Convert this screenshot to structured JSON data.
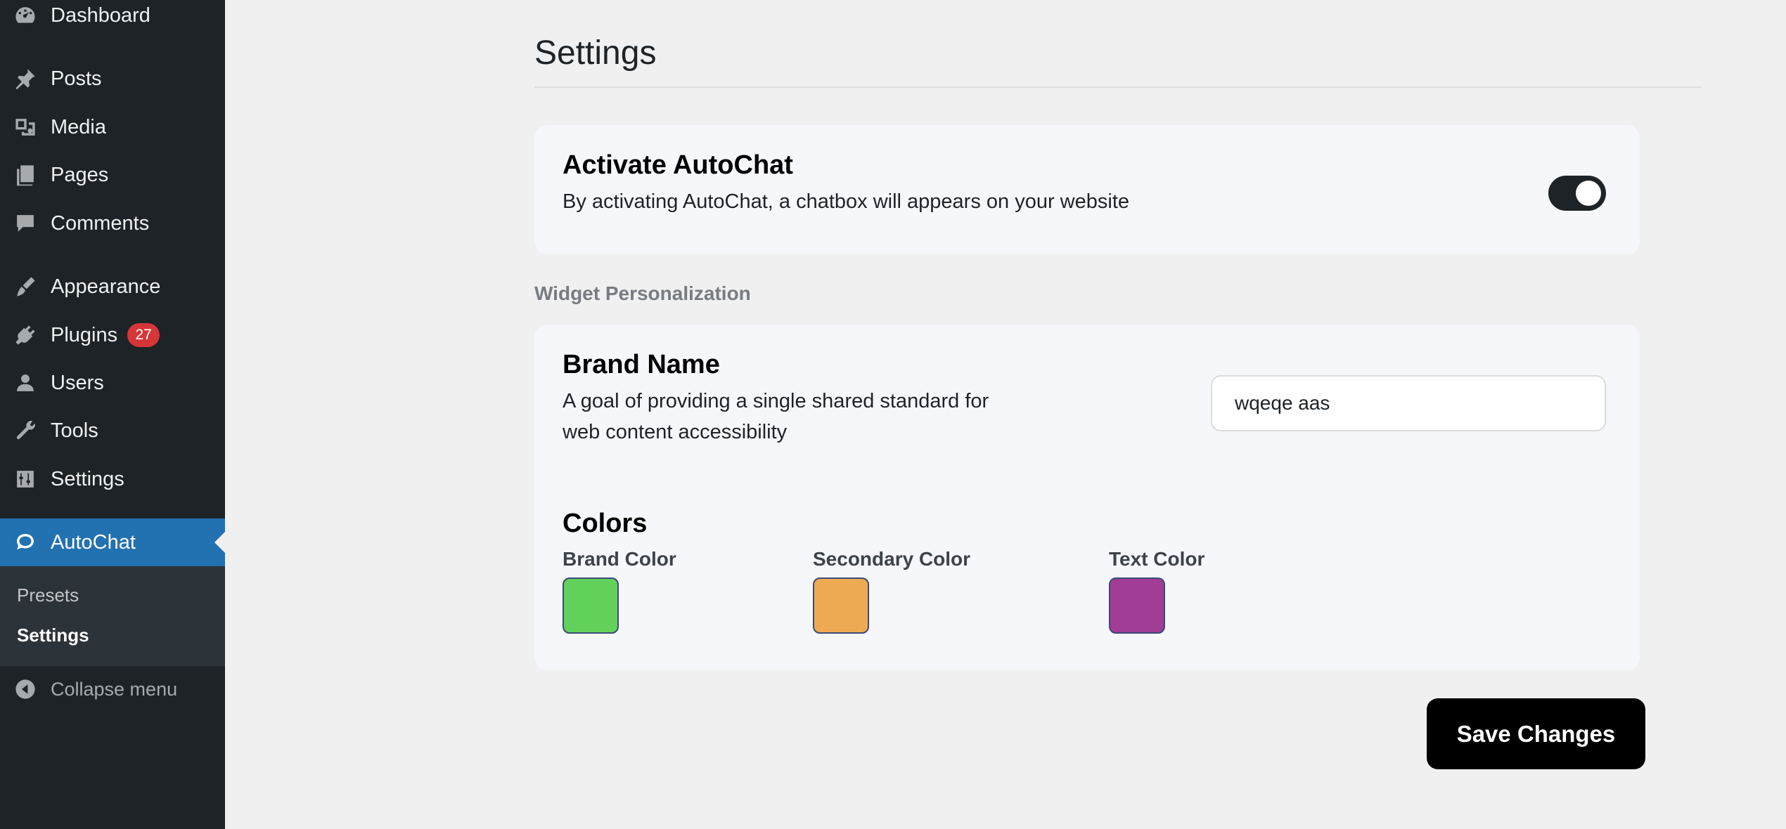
{
  "sidebar": {
    "items": [
      {
        "label": "Dashboard",
        "icon": "dashboard-icon"
      },
      {
        "label": "Posts",
        "icon": "pin-icon"
      },
      {
        "label": "Media",
        "icon": "media-icon"
      },
      {
        "label": "Pages",
        "icon": "pages-icon"
      },
      {
        "label": "Comments",
        "icon": "comment-icon"
      },
      {
        "label": "Appearance",
        "icon": "brush-icon"
      },
      {
        "label": "Plugins",
        "icon": "plug-icon",
        "badge": "27"
      },
      {
        "label": "Users",
        "icon": "user-icon"
      },
      {
        "label": "Tools",
        "icon": "wrench-icon"
      },
      {
        "label": "Settings",
        "icon": "sliders-icon"
      },
      {
        "label": "AutoChat",
        "icon": "chat-icon",
        "active": true
      }
    ],
    "submenu": [
      {
        "label": "Presets"
      },
      {
        "label": "Settings",
        "current": true
      }
    ],
    "collapse_label": "Collapse menu"
  },
  "page": {
    "title": "Settings"
  },
  "activate": {
    "title": "Activate AutoChat",
    "description": "By activating AutoChat, a chatbox will appears on your website",
    "enabled": true
  },
  "widget": {
    "section_label": "Widget Personalization",
    "brand_name": {
      "title": "Brand Name",
      "description_line1": "A goal of providing a single shared standard for",
      "description_line2": "web content accessibility",
      "value": "wqeqe aas"
    },
    "colors": {
      "title": "Colors",
      "brand": {
        "label": "Brand Color",
        "value": "#62d25a"
      },
      "secondary": {
        "label": "Secondary Color",
        "value": "#eeaa52"
      },
      "text": {
        "label": "Text Color",
        "value": "#a13d94"
      }
    }
  },
  "save_label": "Save Changes",
  "theme": {
    "sidebar_bg": "#1d2327",
    "active_bg": "#2271b1",
    "badge_bg": "#d63638"
  }
}
